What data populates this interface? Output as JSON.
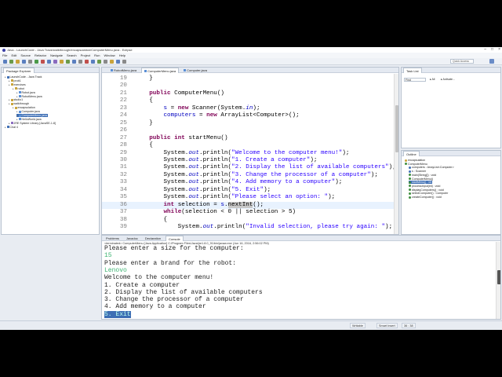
{
  "window": {
    "title": "Java - LaunchCode - Java Track/walkthrough/encapsulation/ComputerMenu.java - Eclipse",
    "minimize": "–",
    "maximize": "□",
    "close": "×"
  },
  "menu": [
    "File",
    "Edit",
    "Source",
    "Refactor",
    "Navigate",
    "Search",
    "Project",
    "Run",
    "Window",
    "Help"
  ],
  "quick_access": {
    "placeholder": "Quick Access"
  },
  "package_explorer": {
    "tab": "Package Explorer",
    "items": [
      {
        "indent": 0,
        "label": "LaunchCode - Java Track",
        "icon": "project-icon"
      },
      {
        "indent": 1,
        "label": "prob1",
        "icon": "package-icon"
      },
      {
        "indent": 1,
        "label": "exercises",
        "icon": "package-icon"
      },
      {
        "indent": 2,
        "label": "robot",
        "icon": "package-icon"
      },
      {
        "indent": 3,
        "label": "Robot.java",
        "icon": "java-file-icon"
      },
      {
        "indent": 3,
        "label": "RobotMenu.java",
        "icon": "java-file-icon"
      },
      {
        "indent": 1,
        "label": "studio1",
        "icon": "package-icon"
      },
      {
        "indent": 1,
        "label": "walkthrough",
        "icon": "package-icon"
      },
      {
        "indent": 2,
        "label": "encapsulation",
        "icon": "package-icon"
      },
      {
        "indent": 3,
        "label": "Computer.java",
        "icon": "java-file-icon"
      },
      {
        "indent": 3,
        "label": "ComputerMenu.java",
        "icon": "java-file-icon",
        "selected": true
      },
      {
        "indent": 3,
        "label": "HelloWorld.java",
        "icon": "java-file-icon"
      },
      {
        "indent": 1,
        "label": "JRE System Library [JavaSE-1.8]",
        "icon": "library-icon"
      },
      {
        "indent": 0,
        "label": "Chal 4",
        "icon": "project-icon"
      }
    ]
  },
  "editor": {
    "tabs": [
      {
        "label": "RobotMenu.java",
        "active": false
      },
      {
        "label": "ComputerMenu.java",
        "active": true
      },
      {
        "label": "Computer.java",
        "active": false
      }
    ],
    "lines": [
      {
        "n": "19",
        "parts": [
          {
            "t": "    }"
          }
        ]
      },
      {
        "n": "20",
        "parts": [
          {
            "t": ""
          }
        ]
      },
      {
        "n": "21",
        "parts": [
          {
            "t": "    "
          },
          {
            "t": "public",
            "c": "kw"
          },
          {
            "t": " ComputerMenu()"
          }
        ]
      },
      {
        "n": "22",
        "parts": [
          {
            "t": "    {"
          }
        ]
      },
      {
        "n": "23",
        "parts": [
          {
            "t": "        "
          },
          {
            "t": "s",
            "c": "fld"
          },
          {
            "t": " = "
          },
          {
            "t": "new",
            "c": "kw"
          },
          {
            "t": " Scanner(System."
          },
          {
            "t": "in",
            "c": "fldi"
          },
          {
            "t": ");"
          }
        ]
      },
      {
        "n": "24",
        "parts": [
          {
            "t": "        "
          },
          {
            "t": "computers",
            "c": "fld"
          },
          {
            "t": " = "
          },
          {
            "t": "new",
            "c": "kw"
          },
          {
            "t": " ArrayList<Computer>();"
          }
        ]
      },
      {
        "n": "25",
        "parts": [
          {
            "t": "    }"
          }
        ]
      },
      {
        "n": "26",
        "parts": [
          {
            "t": ""
          }
        ]
      },
      {
        "n": "27",
        "parts": [
          {
            "t": "    "
          },
          {
            "t": "public",
            "c": "kw"
          },
          {
            "t": " "
          },
          {
            "t": "int",
            "c": "kw"
          },
          {
            "t": " startMenu()"
          }
        ]
      },
      {
        "n": "28",
        "parts": [
          {
            "t": "    {"
          }
        ]
      },
      {
        "n": "29",
        "parts": [
          {
            "t": "        System."
          },
          {
            "t": "out",
            "c": "fldi"
          },
          {
            "t": ".println("
          },
          {
            "t": "\"Welcome to the computer menu!\"",
            "c": "str"
          },
          {
            "t": ");"
          }
        ]
      },
      {
        "n": "30",
        "parts": [
          {
            "t": "        System."
          },
          {
            "t": "out",
            "c": "fldi"
          },
          {
            "t": ".println("
          },
          {
            "t": "\"1. Create a computer\"",
            "c": "str"
          },
          {
            "t": ");"
          }
        ]
      },
      {
        "n": "31",
        "parts": [
          {
            "t": "        System."
          },
          {
            "t": "out",
            "c": "fldi"
          },
          {
            "t": ".println("
          },
          {
            "t": "\"2. Display the list of available computers\"",
            "c": "str"
          },
          {
            "t": ");"
          }
        ]
      },
      {
        "n": "32",
        "parts": [
          {
            "t": "        System."
          },
          {
            "t": "out",
            "c": "fldi"
          },
          {
            "t": ".println("
          },
          {
            "t": "\"3. Change the processor of a computer\"",
            "c": "str"
          },
          {
            "t": ");"
          }
        ]
      },
      {
        "n": "33",
        "parts": [
          {
            "t": "        System."
          },
          {
            "t": "out",
            "c": "fldi"
          },
          {
            "t": ".println("
          },
          {
            "t": "\"4. Add memory to a computer\"",
            "c": "str"
          },
          {
            "t": ");"
          }
        ]
      },
      {
        "n": "34",
        "parts": [
          {
            "t": "        System."
          },
          {
            "t": "out",
            "c": "fldi"
          },
          {
            "t": ".println("
          },
          {
            "t": "\"5. Exit\"",
            "c": "str"
          },
          {
            "t": ");"
          }
        ]
      },
      {
        "n": "35",
        "parts": [
          {
            "t": "        System."
          },
          {
            "t": "out",
            "c": "fldi"
          },
          {
            "t": ".println("
          },
          {
            "t": "\"Please select an option: \"",
            "c": "str"
          },
          {
            "t": ");"
          }
        ]
      },
      {
        "n": "36",
        "current": true,
        "parts": [
          {
            "t": "        "
          },
          {
            "t": "int",
            "c": "kw"
          },
          {
            "t": " selection = "
          },
          {
            "t": "s",
            "c": "fld"
          },
          {
            "t": "."
          },
          {
            "t": "nextInt",
            "c": "hl"
          },
          {
            "t": "();"
          }
        ]
      },
      {
        "n": "37",
        "parts": [
          {
            "t": "        "
          },
          {
            "t": "while",
            "c": "kw"
          },
          {
            "t": "(selection < 0 || selection > 5)"
          }
        ]
      },
      {
        "n": "38",
        "parts": [
          {
            "t": "        {"
          }
        ]
      },
      {
        "n": "39",
        "parts": [
          {
            "t": "            System."
          },
          {
            "t": "out",
            "c": "fldi"
          },
          {
            "t": ".println("
          },
          {
            "t": "\"Invalid selection, please try again: \"",
            "c": "str"
          },
          {
            "t": ");"
          }
        ]
      }
    ]
  },
  "task_list": {
    "tab": "Task List",
    "find_placeholder": "Find",
    "filter_all": "All",
    "filter_activate": "Activate..."
  },
  "outline": {
    "tab": "Outline",
    "items": [
      {
        "indent": 0,
        "label": "encapsulation",
        "icon": "package-icon"
      },
      {
        "indent": 0,
        "label": "ComputerMenu",
        "icon": "class-icon"
      },
      {
        "indent": 1,
        "label": "computers : ArrayList<Computer>",
        "icon": "field-icon"
      },
      {
        "indent": 1,
        "label": "s : Scanner",
        "icon": "field-icon"
      },
      {
        "indent": 1,
        "label": "main(String[]) : void",
        "icon": "method-icon"
      },
      {
        "indent": 1,
        "label": "ComputerMenu()",
        "icon": "method-icon"
      },
      {
        "indent": 1,
        "label": "startMenu() : int",
        "icon": "method-icon",
        "selected": true
      },
      {
        "indent": 1,
        "label": "processInput(int) : void",
        "icon": "method-icon"
      },
      {
        "indent": 1,
        "label": "displayComputers() : void",
        "icon": "method-icon"
      },
      {
        "indent": 1,
        "label": "selectComputer() : Computer",
        "icon": "method-icon"
      },
      {
        "indent": 1,
        "label": "createComputer() : void",
        "icon": "method-icon"
      }
    ]
  },
  "bottom": {
    "tabs": [
      {
        "label": "Problems",
        "active": false
      },
      {
        "label": "Javadoc",
        "active": false
      },
      {
        "label": "Declaration",
        "active": false
      },
      {
        "label": "Console",
        "active": true
      }
    ],
    "console_header": "<terminated> ComputerMenu [Java Application] C:\\Program Files\\Java\\jre1.8.0_91\\bin\\javaw.exe (Jun 16, 2016, 2:56:02 PM)",
    "lines": [
      {
        "t": "Please enter a size for the computer:"
      },
      {
        "t": "15",
        "c": "green"
      },
      {
        "t": "Please enter a brand for the robot:"
      },
      {
        "t": "Lenovo",
        "c": "green"
      },
      {
        "t": "Welcome to the computer menu!"
      },
      {
        "t": "1. Create a computer"
      },
      {
        "t": "2. Display the list of available computers"
      },
      {
        "t": "3. Change the processor of a computer"
      },
      {
        "t": "4. Add memory to a computer"
      },
      {
        "t": "5. Exit",
        "c": "inputsel"
      }
    ]
  },
  "status": {
    "writable": "Writable",
    "insert_mode": "Smart Insert",
    "position": "36 : 38"
  },
  "colors": {
    "selection": "#3d6eb4",
    "keyword": "#7f0055",
    "string": "#2a00ff",
    "field": "#0000c0",
    "console_input": "#3cb371"
  }
}
